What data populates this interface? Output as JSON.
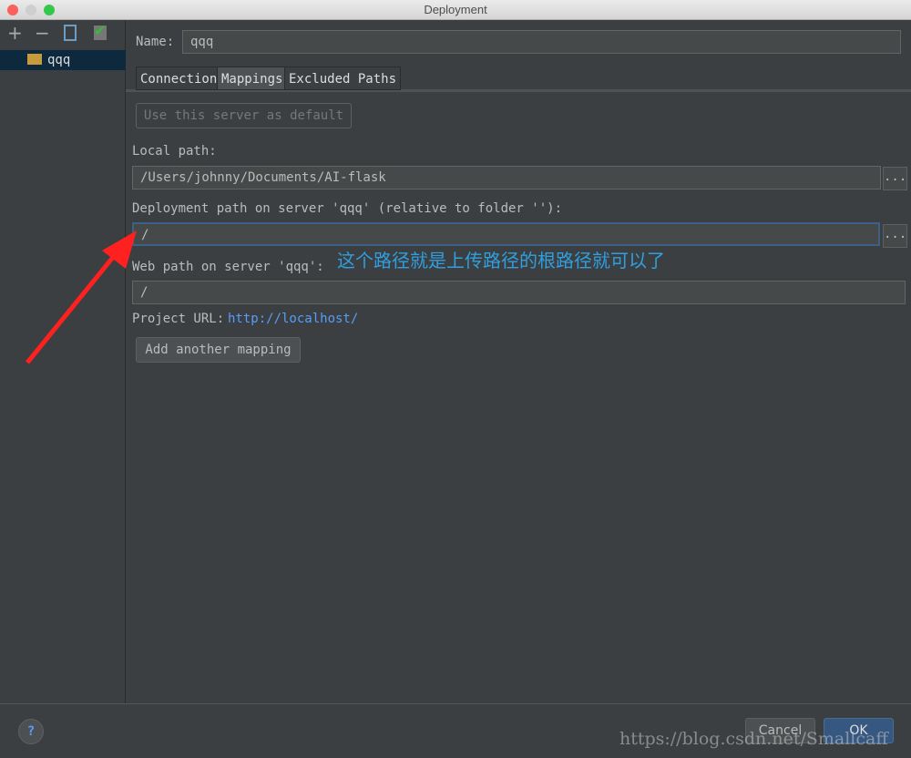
{
  "window": {
    "title": "Deployment"
  },
  "sidebar": {
    "items": [
      {
        "label": "qqq"
      }
    ]
  },
  "form": {
    "name_label": "Name:",
    "name_value": "qqq",
    "tabs": [
      {
        "label": "Connection"
      },
      {
        "label": "Mappings",
        "active": true
      },
      {
        "label": "Excluded Paths"
      }
    ],
    "default_button": "Use this server as default",
    "local_path_label": "Local path:",
    "local_path_value": "/Users/johnny/Documents/AI-flask",
    "deploy_path_label": "Deployment path on server 'qqq' (relative to folder ''):",
    "deploy_path_value": "/",
    "web_path_label": "Web path on server 'qqq':",
    "web_path_value": "/",
    "project_url_label": "Project URL:",
    "project_url_value": "http://localhost/",
    "add_mapping": "Add another mapping",
    "browse": "..."
  },
  "annotation": {
    "text": "这个路径就是上传路径的根路径就可以了",
    "color": "#2f9fe0",
    "arrow_color": "#ff2020"
  },
  "footer": {
    "help": "?",
    "cancel": "Cancel",
    "ok": "OK"
  },
  "watermark": "https://blog.csdn.net/Smallcaff"
}
